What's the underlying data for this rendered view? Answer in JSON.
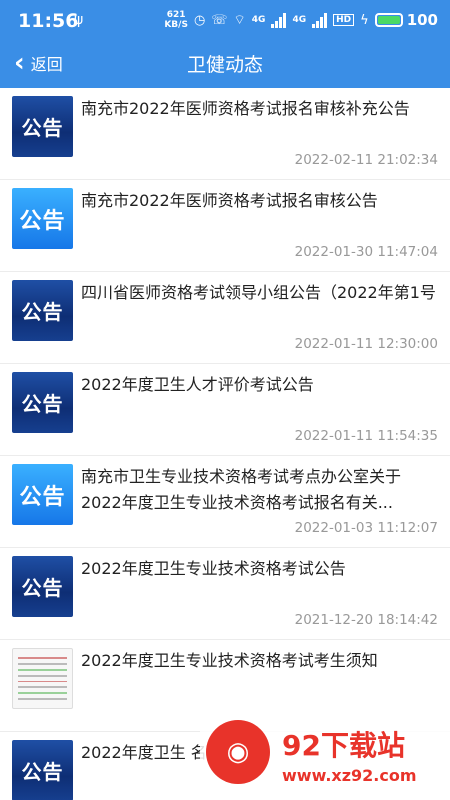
{
  "status_bar": {
    "time": "11:56",
    "net_speed_value": "621",
    "net_speed_unit": "KB/S",
    "network_1": "4G",
    "network_2": "4G",
    "hd": "HD",
    "battery": "100"
  },
  "navbar": {
    "back_label": "返回",
    "title": "卫健动态"
  },
  "items": [
    {
      "title": "南充市2022年医师资格考试报名审核补充公告",
      "date": "2022-02-11 21:02:34",
      "thumb_text": "公告",
      "thumb": "dark"
    },
    {
      "title": "南充市2022年医师资格考试报名审核公告",
      "date": "2022-01-30 11:47:04",
      "thumb_text": "公告",
      "thumb": "bright"
    },
    {
      "title": "四川省医师资格考试领导小组公告（2022年第1号",
      "date": "2022-01-11 12:30:00",
      "thumb_text": "公告",
      "thumb": "dark"
    },
    {
      "title": "2022年度卫生人才评价考试公告",
      "date": "2022-01-11 11:54:35",
      "thumb_text": "公告",
      "thumb": "dark"
    },
    {
      "title": "南充市卫生专业技术资格考试考点办公室关于2022年度卫生专业技术资格考试报名有关...",
      "date": "2022-01-03 11:12:07",
      "thumb_text": "公告",
      "thumb": "bright"
    },
    {
      "title": "2022年度卫生专业技术资格考试公告",
      "date": "2021-12-20 18:14:42",
      "thumb_text": "公告",
      "thumb": "dark"
    },
    {
      "title": "2022年度卫生专业技术资格考试考生须知",
      "date": "",
      "thumb_text": "",
      "thumb": "doc"
    },
    {
      "title": "2022年度卫生 名指南",
      "date": "",
      "thumb_text": "公告",
      "thumb": "dark"
    }
  ],
  "watermark": {
    "name": "92下载站",
    "url": "www.xz92.com"
  },
  "colors": {
    "header": "#3a8ee6",
    "battery": "#4cd964",
    "watermark": "#e8332a"
  }
}
